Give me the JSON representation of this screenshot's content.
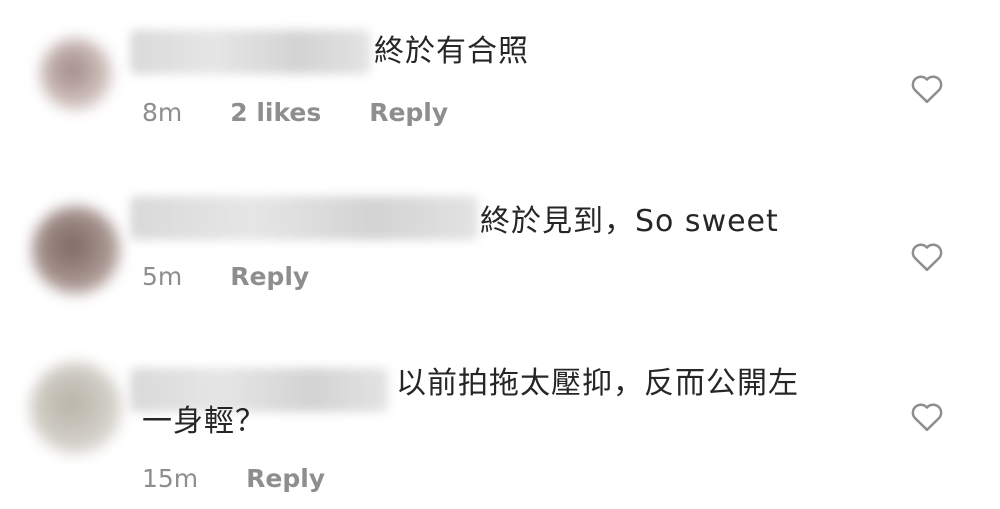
{
  "comments": [
    {
      "text": "終於有合照",
      "time": "8m",
      "likes": "2 likes",
      "reply": "Reply",
      "avatar_color": "#c9b8b3",
      "like_icon": "heart-outline-icon"
    },
    {
      "text": "終於見到，So sweet",
      "time": "5m",
      "reply": "Reply",
      "avatar_color": "#9c857f",
      "like_icon": "heart-outline-icon"
    },
    {
      "text_line1": "以前拍拖太壓抑，反而公開左",
      "text_line2": "一身輕？",
      "time": "15m",
      "reply": "Reply",
      "avatar_color": "#c9c6bd",
      "like_icon": "heart-outline-icon"
    }
  ]
}
